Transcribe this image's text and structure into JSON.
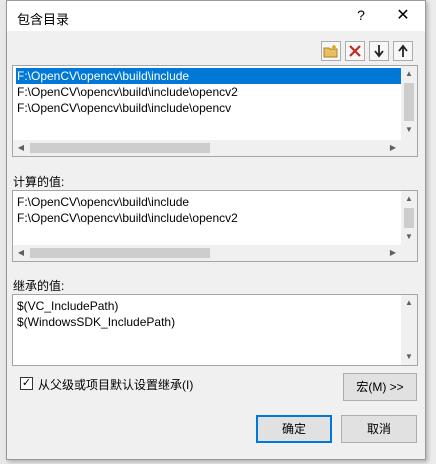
{
  "dialog": {
    "title": "包含目录",
    "help_label": "?",
    "close_label": "✕"
  },
  "toolbar": {
    "new_line_icon": "new-folder-icon",
    "delete_icon": "delete-x-icon",
    "move_down_icon": "arrow-down-icon",
    "move_up_icon": "arrow-up-icon",
    "delete_color": "#c42b1c"
  },
  "paths": {
    "items": [
      "F:\\OpenCV\\opencv\\build\\include",
      "F:\\OpenCV\\opencv\\build\\include\\opencv2",
      "F:\\OpenCV\\opencv\\build\\include\\opencv"
    ],
    "selected_index": 0
  },
  "evaluated": {
    "label": "计算的值:",
    "items": [
      "F:\\OpenCV\\opencv\\build\\include",
      "F:\\OpenCV\\opencv\\build\\include\\opencv2"
    ]
  },
  "inherited": {
    "label": "继承的值:",
    "items": [
      "$(VC_IncludePath)",
      "$(WindowsSDK_IncludePath)"
    ]
  },
  "inherit_checkbox": {
    "label": "从父级或项目默认设置继承(I)",
    "checked": true
  },
  "buttons": {
    "macros": "宏(M) >>",
    "ok": "确定",
    "cancel": "取消"
  },
  "accent_color": "#0078d7"
}
